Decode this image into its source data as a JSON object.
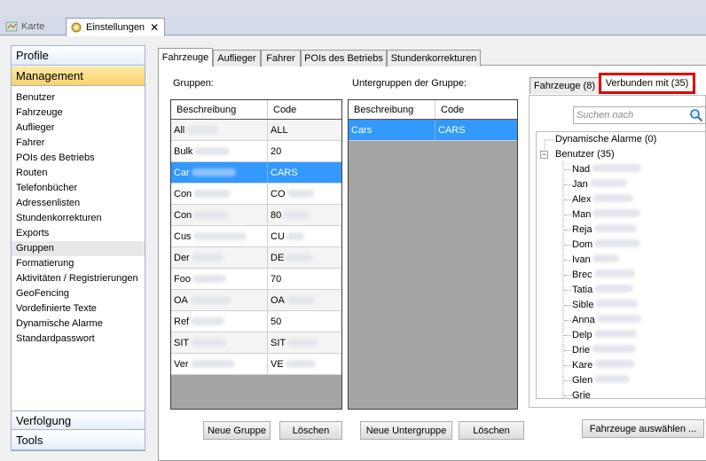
{
  "doc_tabs": [
    {
      "label": "Karte"
    },
    {
      "label": "Einstellungen"
    }
  ],
  "nav": {
    "sections": {
      "profile": "Profile",
      "management": "Management",
      "tracking": "Verfolgung",
      "tools": "Tools"
    },
    "items": [
      "Benutzer",
      "Fahrzeuge",
      "Auflieger",
      "Fahrer",
      "POIs des Betriebs",
      "Routen",
      "Telefonbücher",
      "Adressenlisten",
      "Stundenkorrekturen",
      "Exports",
      "Gruppen",
      "Formatierung",
      "Aktivitäten / Registrierungen",
      "GeoFencing",
      "Vordefinierte Texte",
      "Dynamische Alarme",
      "Standardpasswort"
    ],
    "selected": "Gruppen"
  },
  "main_tabs": [
    "Fahrzeuge",
    "Auflieger",
    "Fahrer",
    "POIs des Betriebs",
    "Stundenkorrekturen"
  ],
  "groups": {
    "label": "Gruppen:",
    "columns": [
      "Beschreibung",
      "Code"
    ],
    "rows": [
      {
        "desc": "All",
        "code": "ALL"
      },
      {
        "desc": "Bulk",
        "code": "20"
      },
      {
        "desc": "Car",
        "code": "CARS"
      },
      {
        "desc": "Con",
        "code": "CO"
      },
      {
        "desc": "Con",
        "code": "80"
      },
      {
        "desc": "Cus",
        "code": "CU"
      },
      {
        "desc": "Der",
        "code": "DE"
      },
      {
        "desc": "Foo",
        "code": "70"
      },
      {
        "desc": "OA",
        "code": "OA"
      },
      {
        "desc": "Ref",
        "code": "50"
      },
      {
        "desc": "SIT",
        "code": "SIT"
      },
      {
        "desc": "Ver",
        "code": "VE"
      }
    ],
    "selected_index": 2
  },
  "subgroups": {
    "label": "Untergruppen der Gruppe:",
    "columns": [
      "Beschreibung",
      "Code"
    ],
    "rows": [
      {
        "desc": "Cars",
        "code": "CARS"
      }
    ]
  },
  "buttons": {
    "new_group": "Neue Gruppe",
    "delete_group": "Löschen",
    "new_subgroup": "Neue Untergruppe",
    "delete_subgroup": "Löschen",
    "select_vehicles": "Fahrzeuge auswählen ..."
  },
  "right_tabs": {
    "vehicles": "Fahrzeuge (8)",
    "connected": "Verbunden mit (35)"
  },
  "search": {
    "placeholder": "Suchen nach"
  },
  "tree": {
    "alarms": "Dynamische Alarme (0)",
    "users": "Benutzer (35)",
    "children": [
      "Nad",
      "Jan",
      "Alex",
      "Man",
      "Reja",
      "Dom",
      "Ivan",
      "Brec",
      "Tatia",
      "Sible",
      "Anna",
      "Delp",
      "Drie",
      "Kare",
      "Glen",
      "Grie"
    ]
  },
  "colors": {
    "selection": "#3399ff",
    "highlight_border": "#e00000",
    "active_section": "#f9d26a"
  }
}
